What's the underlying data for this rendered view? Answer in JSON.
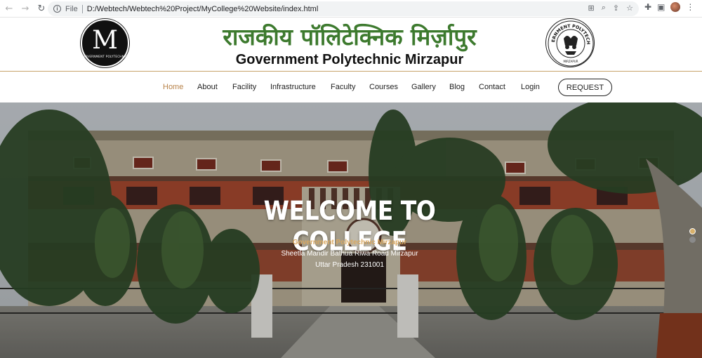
{
  "browser": {
    "scheme": "File",
    "url": "D:/Webtech/Webtech%20Project/MyCollege%20Website/index.html"
  },
  "header": {
    "hindi_title": "राजकीय पॉलिटेक्निक मिर्ज़ापुर",
    "english_title": "Government Polytechnic Mirzapur",
    "left_logo_letter": "M",
    "left_logo_text": "GOVERNMENT POLYTECHNIC",
    "right_logo_text": "GOVERNMENT POLYTECHNIC",
    "right_logo_bottom": "MIRZAPUR"
  },
  "nav": {
    "items": [
      {
        "label": "Home",
        "active": true
      },
      {
        "label": "About"
      },
      {
        "label": "Facility"
      },
      {
        "label": "Infrastructure"
      },
      {
        "label": "Faculty"
      },
      {
        "label": "Courses"
      },
      {
        "label": "Gallery"
      },
      {
        "label": "Blog"
      },
      {
        "label": "Contact"
      },
      {
        "label": "Login"
      }
    ],
    "request_label": "REQUEST"
  },
  "hero": {
    "title": "WELCOME TO COLLEGE",
    "subtitle": "Government Polytechnic Mirzapur",
    "address_line1": "Sheetla Mandir Bathua Riwa Road Mirzapur",
    "address_line2": "Uttar Pradesh 231001",
    "slides": 2,
    "active_slide": 1
  },
  "colors": {
    "accent_gold": "#b8834a",
    "hindi_green": "#3d7a2e"
  }
}
